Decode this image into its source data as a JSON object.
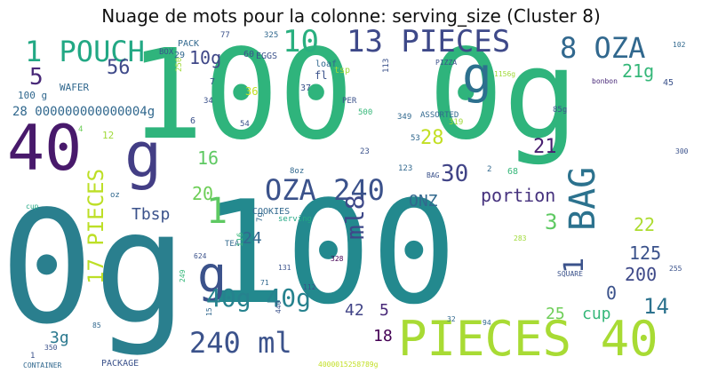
{
  "title": "Nuage de mots pour la colonne: serving_size (Cluster 8)",
  "words": [
    {
      "text": "100 0g",
      "color": "#2fb47c",
      "rotate": 0
    },
    {
      "text": "0g",
      "color": "#2a7f8e",
      "rotate": 0
    },
    {
      "text": "100",
      "color": "#23898e",
      "rotate": 0
    },
    {
      "text": "PIECES 40",
      "color": "#a8db34",
      "rotate": 0
    },
    {
      "text": "40",
      "color": "#48196b",
      "rotate": 0
    },
    {
      "text": "g",
      "color": "#433e85",
      "rotate": 0
    },
    {
      "text": "g",
      "color": "#2d708e",
      "rotate": 0
    },
    {
      "text": "g",
      "color": "#3b528b",
      "rotate": 0
    },
    {
      "text": "1 POUCH",
      "color": "#22a884",
      "rotate": 0
    },
    {
      "text": "10",
      "color": "#29af7f",
      "rotate": 0
    },
    {
      "text": "13 PIECES",
      "color": "#3e4989",
      "rotate": 0
    },
    {
      "text": "8 OZA",
      "color": "#31688e",
      "rotate": 0
    },
    {
      "text": "OZA 240",
      "color": "#3b528b",
      "rotate": 0
    },
    {
      "text": "BAG",
      "color": "#2c728e",
      "rotate": -90
    },
    {
      "text": "240 ml",
      "color": "#3b528b",
      "rotate": 0
    },
    {
      "text": "17 PIECES",
      "color": "#bddf26",
      "rotate": -90
    },
    {
      "text": "40g 40g",
      "color": "#26828e",
      "rotate": 0
    },
    {
      "text": "ml8",
      "color": "#3e4989",
      "rotate": -90
    },
    {
      "text": "1",
      "color": "#5ec962",
      "rotate": 0
    },
    {
      "text": "5",
      "color": "#482878",
      "rotate": 0
    },
    {
      "text": "56",
      "color": "#3e4989",
      "rotate": 0
    },
    {
      "text": "10g",
      "color": "#3f4788",
      "rotate": 0
    },
    {
      "text": "21g",
      "color": "#35b779",
      "rotate": 0
    },
    {
      "text": "28",
      "color": "#c2df23",
      "rotate": 0
    },
    {
      "text": "30",
      "color": "#414487",
      "rotate": 0
    },
    {
      "text": "21",
      "color": "#481f70",
      "rotate": 0
    },
    {
      "text": "16",
      "color": "#5ec962",
      "rotate": 0
    },
    {
      "text": "20",
      "color": "#6ece58",
      "rotate": 0
    },
    {
      "text": "Tbsp",
      "color": "#3b528b",
      "rotate": 0
    },
    {
      "text": "portion",
      "color": "#46327e",
      "rotate": 0
    },
    {
      "text": "ONZ",
      "color": "#31688e",
      "rotate": 0
    },
    {
      "text": "3",
      "color": "#5ec962",
      "rotate": 0
    },
    {
      "text": "22",
      "color": "#addc30",
      "rotate": 0
    },
    {
      "text": "125",
      "color": "#3b528b",
      "rotate": 0
    },
    {
      "text": "200",
      "color": "#3e4989",
      "rotate": 0
    },
    {
      "text": "14",
      "color": "#2c728e",
      "rotate": 0
    },
    {
      "text": "cup",
      "color": "#35b779",
      "rotate": 0
    },
    {
      "text": "25",
      "color": "#6ece58",
      "rotate": 0
    },
    {
      "text": "1",
      "color": "#3b528b",
      "rotate": -90
    },
    {
      "text": "0",
      "color": "#3b528b",
      "rotate": 0
    },
    {
      "text": "24",
      "color": "#31688e",
      "rotate": 0
    },
    {
      "text": "42",
      "color": "#414487",
      "rotate": 0
    },
    {
      "text": "5",
      "color": "#482878",
      "rotate": 0
    },
    {
      "text": "18",
      "color": "#440154",
      "rotate": 0
    },
    {
      "text": "3g",
      "color": "#2a788e",
      "rotate": 0
    },
    {
      "text": "28 000000000000004g",
      "color": "#31688e",
      "rotate": 0
    },
    {
      "text": "100 g",
      "color": "#31688e",
      "rotate": 0
    },
    {
      "text": "WAFER",
      "color": "#31688e",
      "rotate": 0
    },
    {
      "text": "PACK",
      "color": "#31688e",
      "rotate": 0
    },
    {
      "text": "BOX",
      "color": "#3b528b",
      "rotate": 0
    },
    {
      "text": "29",
      "color": "#31688e",
      "rotate": 0
    },
    {
      "text": "60",
      "color": "#3b528b",
      "rotate": 0
    },
    {
      "text": "EGGS",
      "color": "#3b528b",
      "rotate": 0
    },
    {
      "text": "77",
      "color": "#3b528b",
      "rotate": 0
    },
    {
      "text": "325",
      "color": "#31688e",
      "rotate": 0
    },
    {
      "text": "loaf",
      "color": "#31688e",
      "rotate": 0
    },
    {
      "text": "fl",
      "color": "#3b528b",
      "rotate": 0
    },
    {
      "text": "tsp",
      "color": "#a0da39",
      "rotate": 0
    },
    {
      "text": "PIZZA",
      "color": "#3b528b",
      "rotate": 0
    },
    {
      "text": "1156g",
      "color": "#a0da39",
      "rotate": 0
    },
    {
      "text": "102",
      "color": "#31688e",
      "rotate": 0
    },
    {
      "text": "bonbon",
      "color": "#482878",
      "rotate": 0
    },
    {
      "text": "45",
      "color": "#3b528b",
      "rotate": 0
    },
    {
      "text": "7",
      "color": "#3b528b",
      "rotate": 0
    },
    {
      "text": "250",
      "color": "#a0da39",
      "rotate": -90
    },
    {
      "text": "36",
      "color": "#c2df23",
      "rotate": 0
    },
    {
      "text": "37",
      "color": "#3b528b",
      "rotate": 0
    },
    {
      "text": "113",
      "color": "#3b528b",
      "rotate": -90
    },
    {
      "text": "34",
      "color": "#3b528b",
      "rotate": 0
    },
    {
      "text": "PER",
      "color": "#3b528b",
      "rotate": 0
    },
    {
      "text": "500",
      "color": "#35b779",
      "rotate": 0
    },
    {
      "text": "349",
      "color": "#31688e",
      "rotate": 0
    },
    {
      "text": "ASSORTED",
      "color": "#31688e",
      "rotate": 0
    },
    {
      "text": "319",
      "color": "#a0da39",
      "rotate": 0
    },
    {
      "text": "85g",
      "color": "#3b528b",
      "rotate": 0
    },
    {
      "text": "6",
      "color": "#3b528b",
      "rotate": 0
    },
    {
      "text": "54",
      "color": "#3b528b",
      "rotate": 0
    },
    {
      "text": "53",
      "color": "#31688e",
      "rotate": 0
    },
    {
      "text": "4",
      "color": "#6ece58",
      "rotate": 0
    },
    {
      "text": "12",
      "color": "#a0da39",
      "rotate": 0
    },
    {
      "text": "23",
      "color": "#3b528b",
      "rotate": 0
    },
    {
      "text": "8oz",
      "color": "#31688e",
      "rotate": 0
    },
    {
      "text": "123",
      "color": "#31688e",
      "rotate": 0
    },
    {
      "text": "BAG",
      "color": "#3b528b",
      "rotate": 0
    },
    {
      "text": "2",
      "color": "#31688e",
      "rotate": 0
    },
    {
      "text": "68",
      "color": "#35b779",
      "rotate": 0
    },
    {
      "text": "300",
      "color": "#3b528b",
      "rotate": 0
    },
    {
      "text": "oz",
      "color": "#31688e",
      "rotate": 0
    },
    {
      "text": "cup",
      "color": "#22a884",
      "rotate": 0
    },
    {
      "text": "COOKIES",
      "color": "#31688e",
      "rotate": 0
    },
    {
      "text": "serving",
      "color": "#22a884",
      "rotate": 0
    },
    {
      "text": "7g",
      "color": "#31688e",
      "rotate": -90
    },
    {
      "text": "TEA",
      "color": "#31688e",
      "rotate": 0
    },
    {
      "text": "116",
      "color": "#35b779",
      "rotate": -90
    },
    {
      "text": "624",
      "color": "#3b528b",
      "rotate": 0
    },
    {
      "text": "283",
      "color": "#a0da39",
      "rotate": 0
    },
    {
      "text": "255",
      "color": "#3b528b",
      "rotate": 0
    },
    {
      "text": "328",
      "color": "#440154",
      "rotate": 0
    },
    {
      "text": "131",
      "color": "#3b528b",
      "rotate": 0
    },
    {
      "text": "SQUARE",
      "color": "#3b528b",
      "rotate": 0
    },
    {
      "text": "249",
      "color": "#35b779",
      "rotate": -90
    },
    {
      "text": "71",
      "color": "#31688e",
      "rotate": 0
    },
    {
      "text": "112",
      "color": "#3b528b",
      "rotate": 0
    },
    {
      "text": "440",
      "color": "#3b528b",
      "rotate": -90
    },
    {
      "text": "15",
      "color": "#31688e",
      "rotate": -90
    },
    {
      "text": "85",
      "color": "#31688e",
      "rotate": 0
    },
    {
      "text": "32",
      "color": "#31688e",
      "rotate": 0
    },
    {
      "text": "94",
      "color": "#31688e",
      "rotate": 0
    },
    {
      "text": "1",
      "color": "#3b528b",
      "rotate": 0
    },
    {
      "text": "350",
      "color": "#3b528b",
      "rotate": 0
    },
    {
      "text": "PACKAGE",
      "color": "#3b528b",
      "rotate": 0
    },
    {
      "text": "CONTAINER",
      "color": "#31688e",
      "rotate": 0
    },
    {
      "text": "4000015258789g",
      "color": "#c2df23",
      "rotate": 0
    }
  ]
}
